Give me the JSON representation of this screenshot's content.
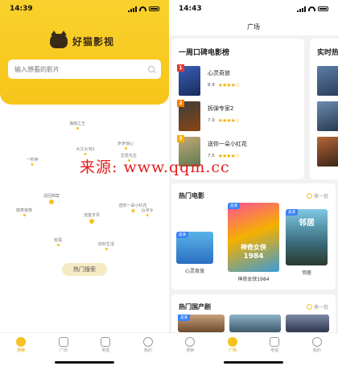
{
  "left": {
    "status": {
      "time": "14:39"
    },
    "logo_text": "好猫影视",
    "search": {
      "placeholder": "输入想看的影片"
    },
    "cloud_tags": [
      "海浪之王",
      "大江大河2",
      "一秒钟",
      "步步惊心",
      "恋爱先生",
      "泥回档案",
      "搞笑家族",
      "流金岁月",
      "送你一朵小红花",
      "有翡",
      "好好生活",
      "山河令"
    ],
    "hot_search_label": "热门搜索",
    "tabs": [
      {
        "label": "搜索",
        "icon": "search-icon",
        "active": true
      },
      {
        "label": "广场",
        "icon": "cat-icon",
        "active": false
      },
      {
        "label": "电视",
        "icon": "tv-icon",
        "active": false
      },
      {
        "label": "我的",
        "icon": "user-icon",
        "active": false
      }
    ]
  },
  "right": {
    "status": {
      "time": "14:43"
    },
    "title": "广场",
    "rank": {
      "title": "一周口碑电影榜",
      "items": [
        {
          "rank": "1",
          "name": "心灵奇旅",
          "score": "8.9"
        },
        {
          "rank": "2",
          "name": "拆弹专家2",
          "score": "7.9"
        },
        {
          "rank": "3",
          "name": "送你一朵小红花",
          "score": "7.5"
        }
      ]
    },
    "rank2_title": "实时热",
    "hot_movies": {
      "title": "热门电影",
      "swap": "换一批",
      "items": [
        {
          "name": "心灵奇旅",
          "badge": "高清"
        },
        {
          "name": "神奇女侠1984",
          "badge": "高清",
          "poster_text": "神奇女侠",
          "poster_year": "1984"
        },
        {
          "name": "邻居",
          "badge": "高清",
          "poster_text": "邻居"
        }
      ]
    },
    "hot_tv": {
      "title": "热门国产剧",
      "swap": "换一批",
      "badge": "高清"
    },
    "tabs": [
      {
        "label": "搜索",
        "icon": "search-icon",
        "active": false
      },
      {
        "label": "广场",
        "icon": "cat-icon",
        "active": true
      },
      {
        "label": "电视",
        "icon": "tv-icon",
        "active": false
      },
      {
        "label": "我的",
        "icon": "user-icon",
        "active": false
      }
    ]
  },
  "watermark": "来源: www.qqm.cc",
  "colors": {
    "accent": "#f5c220",
    "header": "#f9d12c",
    "watermark": "#e31c1c"
  }
}
